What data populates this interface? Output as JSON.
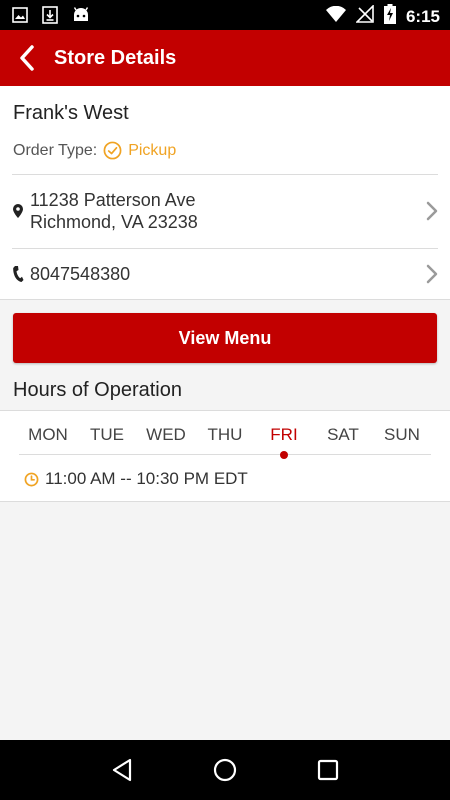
{
  "status_bar": {
    "time": "6:15",
    "icons": [
      "image-icon",
      "download-icon",
      "android-icon",
      "wifi-icon",
      "no-signal-icon",
      "battery-charging-icon"
    ]
  },
  "app_bar": {
    "title": "Store Details",
    "back_icon": "chevron-left-icon"
  },
  "store": {
    "name": "Frank's West",
    "order_type_label": "Order Type:",
    "order_type_value": "Pickup",
    "address_line1": "11238 Patterson Ave",
    "address_line2": "Richmond, VA 23238",
    "phone": "8047548380"
  },
  "actions": {
    "view_menu": "View Menu"
  },
  "hours": {
    "title": "Hours of Operation",
    "days": [
      "MON",
      "TUE",
      "WED",
      "THU",
      "FRI",
      "SAT",
      "SUN"
    ],
    "selected_day": "FRI",
    "text": "11:00 AM -- 10:30 PM EDT"
  },
  "colors": {
    "brand": "#c20000",
    "accent": "#f0a323"
  },
  "nav_bar": {
    "icons": [
      "back-triangle-icon",
      "home-circle-icon",
      "recents-square-icon"
    ]
  }
}
